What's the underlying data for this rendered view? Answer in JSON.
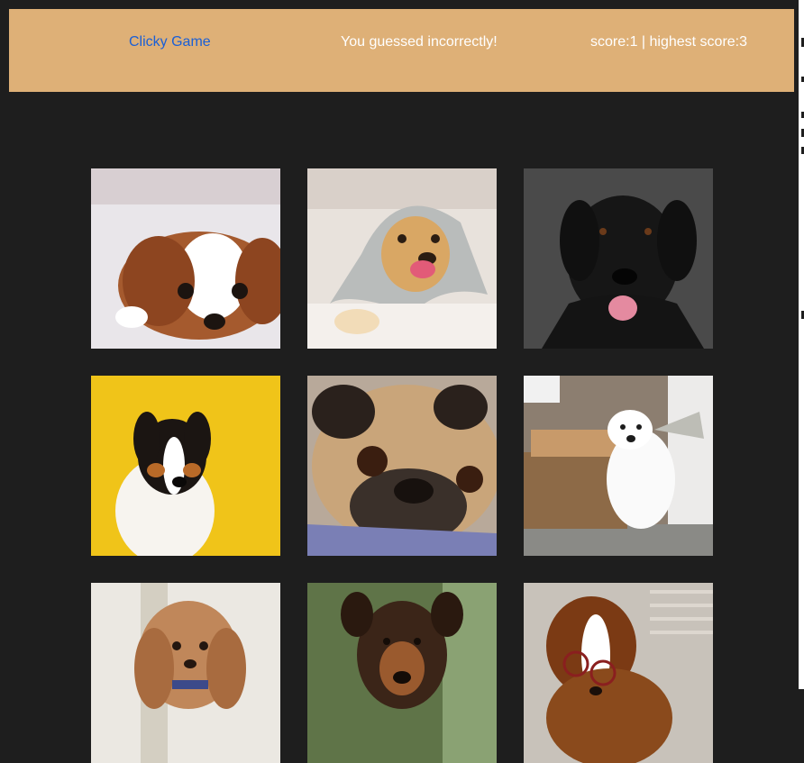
{
  "navbar": {
    "brand": "Clicky Game",
    "message": "You guessed incorrectly!",
    "score_text": "score:1 | highest score:3",
    "background": "#deb077",
    "brand_color": "#1a5fd6"
  },
  "cards": [
    {
      "name": "card-cavalier-puppy",
      "subject": "cavalier king charles puppy"
    },
    {
      "name": "card-golden-retriever-blanket",
      "subject": "golden retriever under blanket"
    },
    {
      "name": "card-black-labrador",
      "subject": "black labrador"
    },
    {
      "name": "card-australian-shepherd",
      "subject": "australian shepherd on yellow background"
    },
    {
      "name": "card-pug",
      "subject": "pug"
    },
    {
      "name": "card-white-spitz",
      "subject": "white spitz at dog door"
    },
    {
      "name": "card-doodle",
      "subject": "cockapoo doodle"
    },
    {
      "name": "card-hound-mix",
      "subject": "brown hound mix"
    },
    {
      "name": "card-dog-with-glasses",
      "subject": "dog wearing glasses"
    }
  ],
  "page": {
    "background": "#1e1e1e"
  }
}
